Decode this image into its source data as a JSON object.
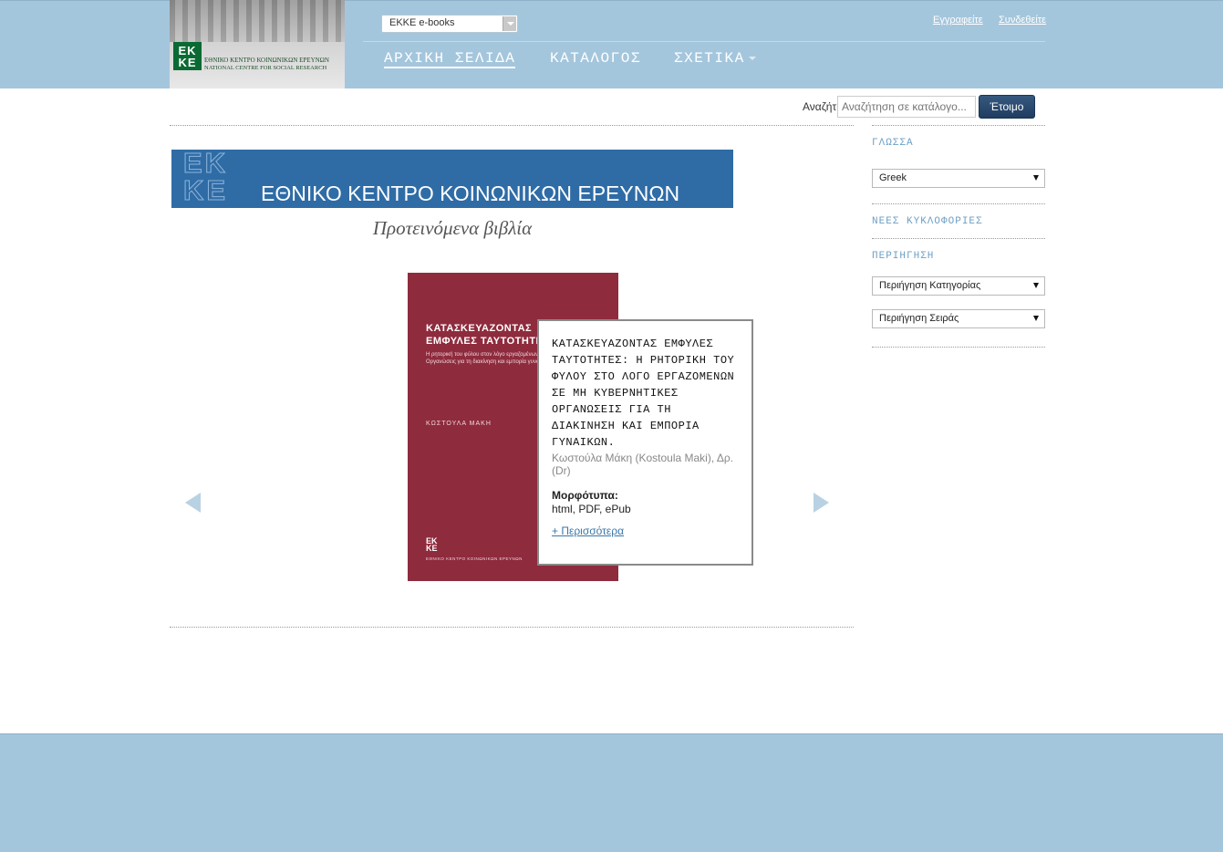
{
  "header": {
    "site_selector": "EKKE e-books",
    "register": "Εγγραφείτε",
    "login": "Συνδεθείτε",
    "nav": [
      {
        "label": "ΑΡΧΙΚΗ ΣΕΛΙΔΑ"
      },
      {
        "label": "ΚΑΤΑΛΟΓΟΣ"
      },
      {
        "label": "ΣΧΕΤΙΚΑ"
      }
    ],
    "logo": {
      "mark": "EK KE",
      "name_gr": "ΕΘΝΙΚΟ ΚΕΝΤΡΟ ΚΟΙΝΩΝΙΚΩΝ ΕΡΕΥΝΩΝ",
      "name_en": "NATIONAL CENTRE FOR SOCIAL RESEARCH"
    }
  },
  "search": {
    "placeholder": "Αναζήτηση σε κατάλογο...",
    "label": "Αναζήτηση σε κατάλογο...",
    "button": "Έτοιμο"
  },
  "banner": {
    "logo_letters": "EK KE",
    "title": "ΕΘΝΙΚΟ ΚΕΝΤΡΟ ΚΟΙΝΩΝΙΚΩΝ ΕΡΕΥΝΩΝ"
  },
  "featured": {
    "heading": "Προτεινόμενα βιβλία",
    "book": {
      "cover_title_1": "ΚΑΤΑΣΚΕΥΑΖΟΝΤΑΣ",
      "cover_title_2": "ΕΜΦΥΛΕΣ ΤΑΥΤΟΤΗΤΕΣ",
      "cover_subtitle": "Η ρητορική του φύλου στον λόγο εργαζομένων σε Μη Κυβερνητικές Οργανώσεις για τη διακίνηση και εμπορία γυναικών",
      "cover_author": "ΚΩΣΤΟΥΛΑ ΜΑΚΗ",
      "cover_publisher_mark": "EK KE",
      "cover_publisher": "ΕΘΝΙΚΟ ΚΕΝΤΡΟ ΚΟΙΝΩΝΙΚΩΝ ΕΡΕΥΝΩΝ",
      "title": "ΚΑΤΑΣΚΕΥΑΖΟΝΤΑΣ ΕΜΦΥΛΕΣ ΤΑΥΤΟΤΗΤΕΣ: Η ΡΗΤΟΡΙΚΗ ΤΟΥ ΦΥΛΟΥ ΣΤΟ ΛΟΓΟ ΕΡΓΑΖΟΜΕΝΩΝ ΣΕ ΜΗ ΚΥΒΕΡΝΗΤΙΚΕΣ ΟΡΓΑΝΩΣΕΙΣ ΓΙΑ ΤΗ ΔΙΑΚΙΝΗΣΗ ΚΑΙ ΕΜΠΟΡΙΑ ΓΥΝΑΙΚΩΝ.",
      "author": "Κωστούλα Μάκη (Kostoula Maki), Δρ. (Dr)",
      "formats_label": "Μορφότυπα:",
      "formats": "html, PDF, ePub",
      "more": "+ Περισσότερα"
    }
  },
  "sidebar": {
    "language_heading": "ΓΛΩΣΣΑ",
    "language_value": "Greek",
    "new_releases": "ΝΕΕΣ ΚΥΚΛΟΦΟΡΙΕΣ",
    "browse_heading": "ΠΕΡΙΗΓΗΣΗ",
    "browse_category": "Περιήγηση Κατηγορίας",
    "browse_series": "Περιήγηση Σειράς"
  },
  "colors": {
    "header_bg": "#a4c6dc",
    "banner_bg": "#2f6ca6",
    "cover_bg": "#8e2b3d",
    "button_bg": "#203d60"
  },
  "icons": {
    "prev": "arrow-left-icon",
    "next": "arrow-right-icon",
    "dropdown": "triangle-down-icon"
  }
}
